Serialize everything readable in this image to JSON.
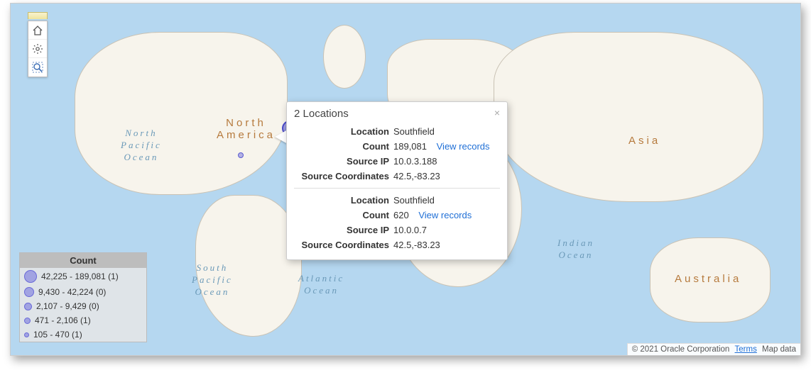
{
  "map": {
    "labels": {
      "north_america": "North\nAmerica",
      "asia": "Asia",
      "australia": "Australia",
      "north_pacific": "North\nPacific\nOcean",
      "south_pacific": "South\nPacific\nOcean",
      "atlantic": "Atlantic\nOcean",
      "indian": "Indian\nOcean"
    }
  },
  "toolbar": {
    "home_icon": "home-icon",
    "settings_icon": "gear-icon",
    "zoom_icon": "zoom-area-icon"
  },
  "popup": {
    "title": "2 Locations",
    "close": "×",
    "view_records": "View records",
    "keys": {
      "location": "Location",
      "count": "Count",
      "source_ip": "Source IP",
      "source_coords": "Source Coordinates"
    },
    "items": [
      {
        "location": "Southfield",
        "count": "189,081",
        "source_ip": "10.0.3.188",
        "source_coords": "42.5,-83.23"
      },
      {
        "location": "Southfield",
        "count": "620",
        "source_ip": "10.0.0.7",
        "source_coords": "42.5,-83.23"
      }
    ]
  },
  "legend": {
    "title": "Count",
    "rows": [
      {
        "range": "42,225 - 189,081",
        "n": "(1)",
        "size": 18
      },
      {
        "range": "9,430 - 42,224",
        "n": "(0)",
        "size": 14
      },
      {
        "range": "2,107 - 9,429",
        "n": "(0)",
        "size": 11
      },
      {
        "range": "471 - 2,106",
        "n": "(1)",
        "size": 9
      },
      {
        "range": "105 - 470",
        "n": "(1)",
        "size": 7
      }
    ]
  },
  "attribution": {
    "copyright": "© 2021 Oracle Corporation",
    "terms": "Terms",
    "mapdata": "Map data"
  }
}
